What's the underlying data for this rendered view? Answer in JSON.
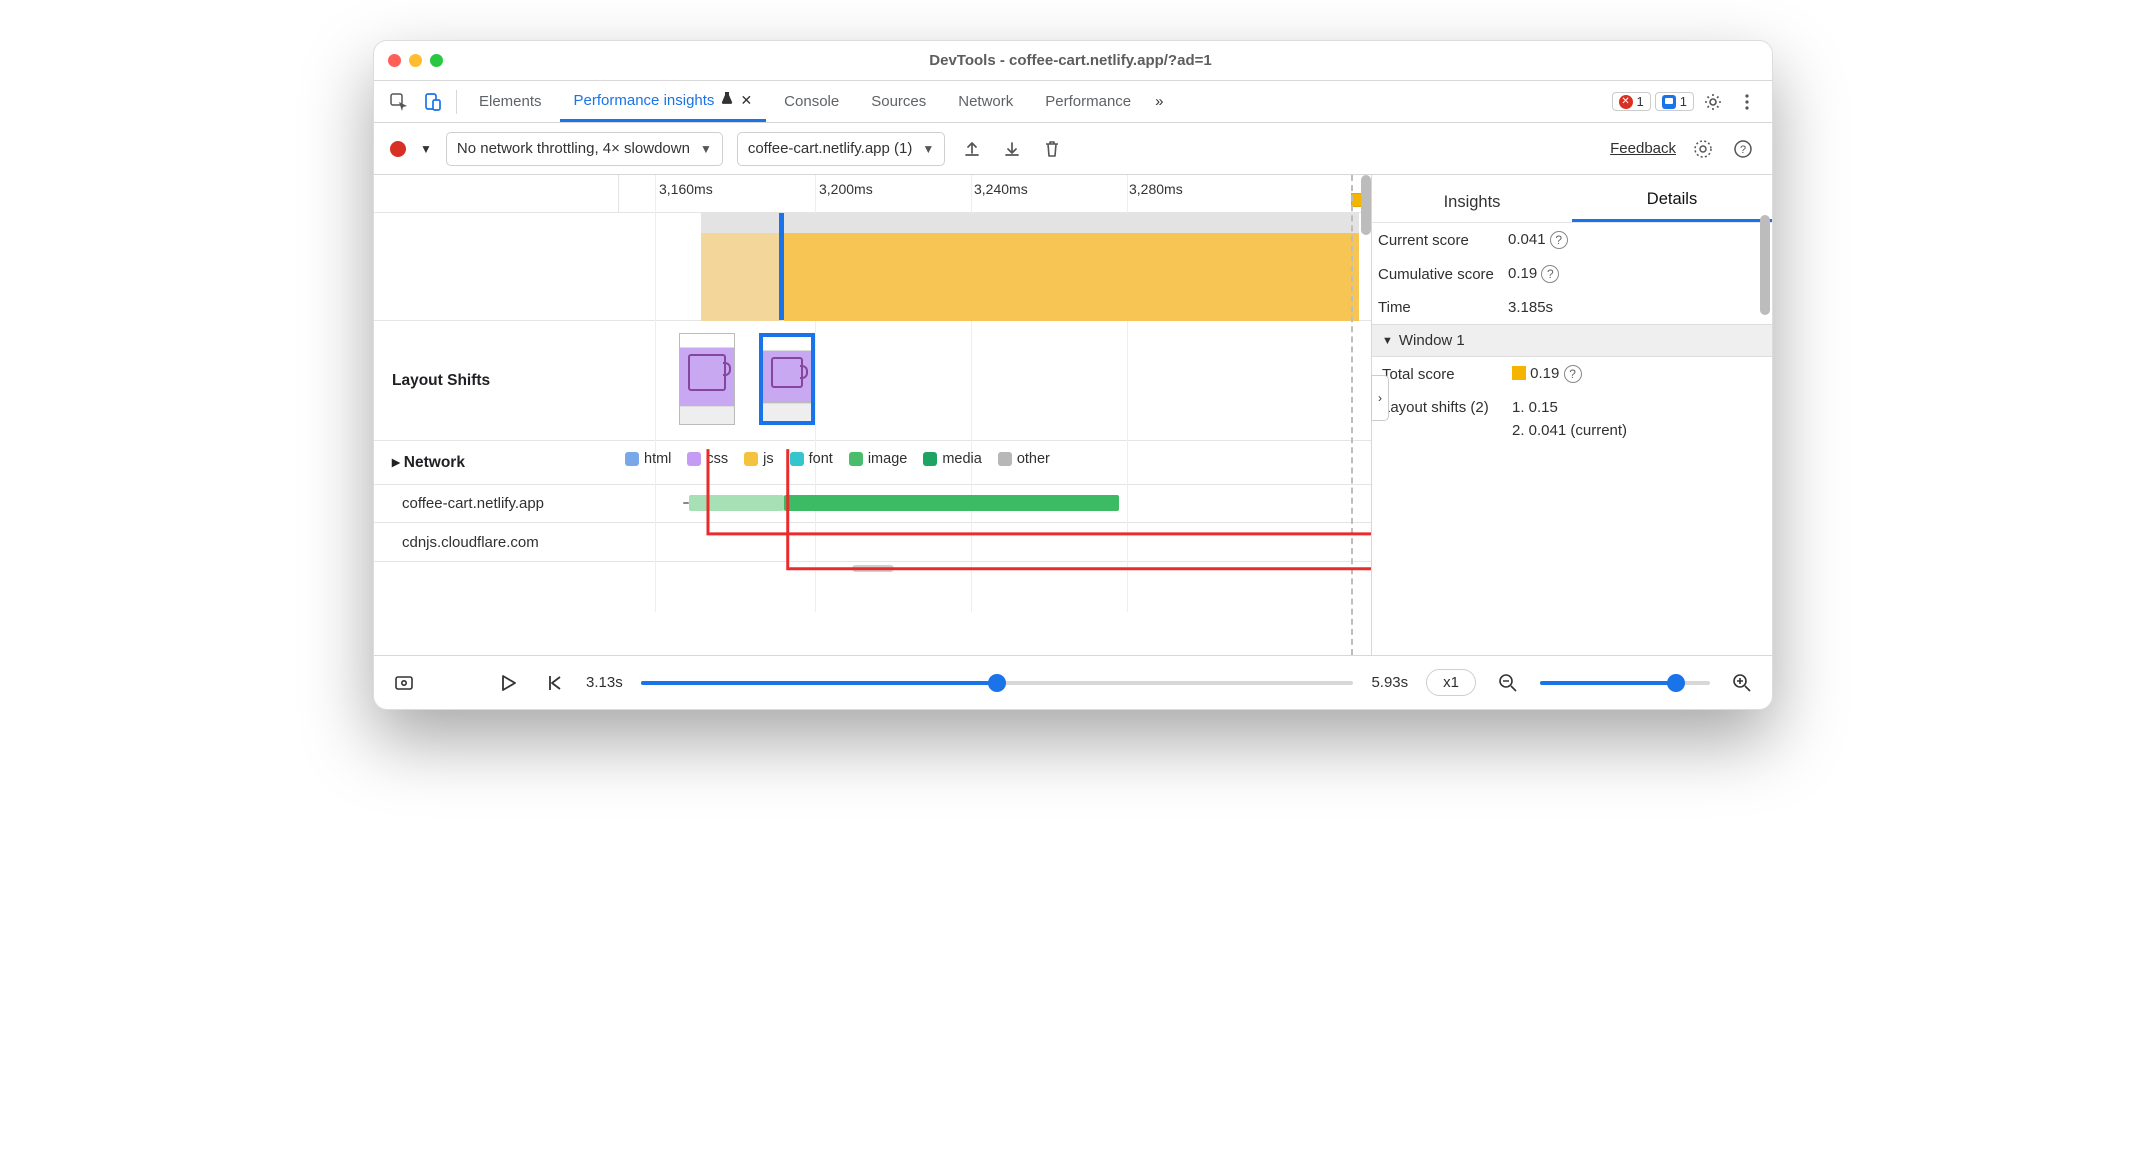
{
  "window": {
    "title": "DevTools - coffee-cart.netlify.app/?ad=1"
  },
  "tabs": {
    "items": [
      "Elements",
      "Performance insights",
      "Console",
      "Sources",
      "Network",
      "Performance"
    ],
    "active_index": 1,
    "error_count": "1",
    "message_count": "1"
  },
  "subtoolbar": {
    "throttling_label": "No network throttling, 4× slowdown",
    "recording_label": "coffee-cart.netlify.app (1)",
    "feedback": "Feedback"
  },
  "ruler_ticks": [
    "3,160ms",
    "3,200ms",
    "3,240ms",
    "3,280ms"
  ],
  "tracks": {
    "layout_shifts": {
      "label": "Layout Shifts"
    },
    "network": {
      "label": "Network"
    },
    "network_rows": [
      "coffee-cart.netlify.app",
      "cdnjs.cloudflare.com"
    ]
  },
  "legend": {
    "html": "html",
    "css": "css",
    "js": "js",
    "font": "font",
    "image": "image",
    "media": "media",
    "other": "other"
  },
  "right": {
    "tab_insights": "Insights",
    "tab_details": "Details",
    "current_score_k": "Current score",
    "current_score_v": "0.041",
    "cumulative_k": "Cumulative score",
    "cumulative_v": "0.19",
    "time_k": "Time",
    "time_v": "3.185s",
    "window1": "Window 1",
    "total_k": "Total score",
    "total_v": "0.19",
    "ls_k": "Layout shifts (2)",
    "ls1": "1. 0.15",
    "ls2": "2. 0.041 (current)"
  },
  "footer": {
    "t_start": "3.13s",
    "t_end": "5.93s",
    "speed": "x1"
  }
}
